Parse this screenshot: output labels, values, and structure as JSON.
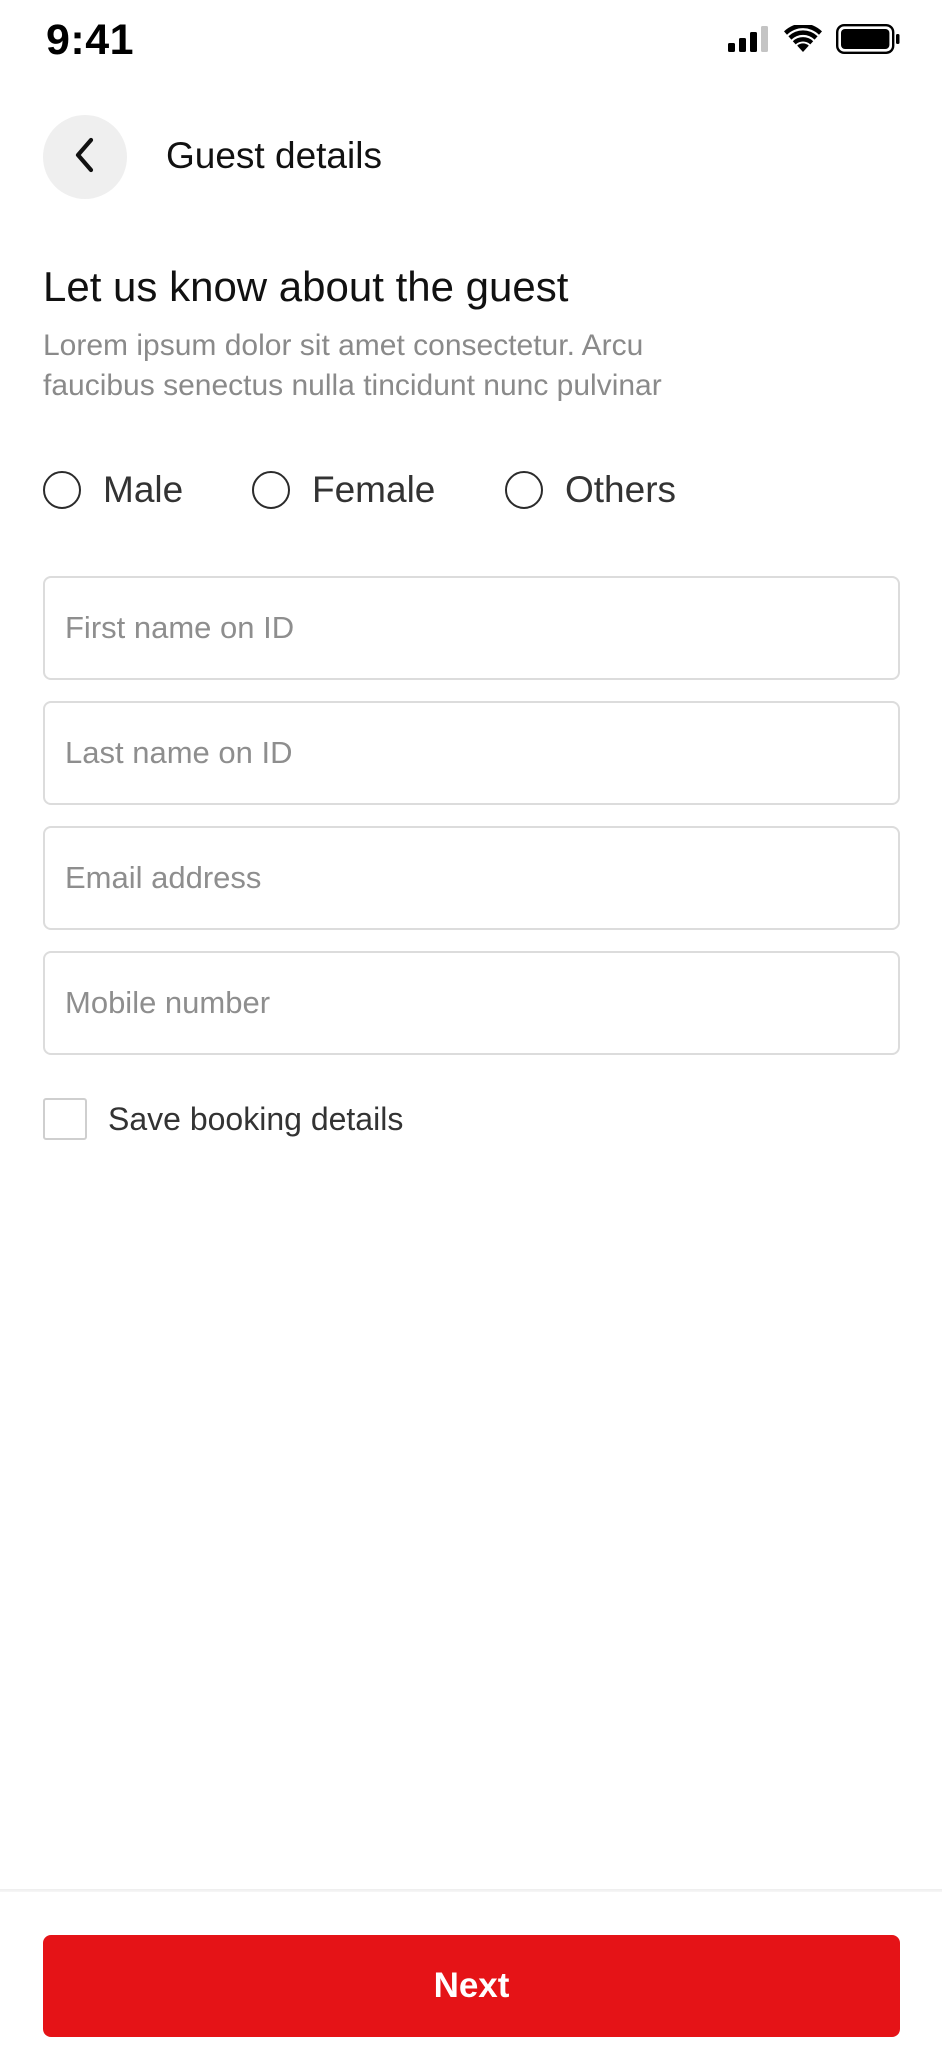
{
  "status_bar": {
    "time": "9:41",
    "icons": [
      "cellular-signal-icon",
      "wifi-icon",
      "battery-icon"
    ]
  },
  "header": {
    "back_icon": "chevron-left-icon",
    "title": "Guest details"
  },
  "section": {
    "title": "Let us know about the guest",
    "description": "Lorem ipsum dolor sit amet consectetur. Arcu faucibus senectus nulla tincidunt nunc pulvinar"
  },
  "gender_options": [
    {
      "label": "Male",
      "selected": false
    },
    {
      "label": "Female",
      "selected": false
    },
    {
      "label": "Others",
      "selected": false
    }
  ],
  "form": {
    "first_name": {
      "placeholder": "First name on ID",
      "value": ""
    },
    "last_name": {
      "placeholder": "Last name on ID",
      "value": ""
    },
    "email": {
      "placeholder": "Email address",
      "value": ""
    },
    "mobile": {
      "placeholder": "Mobile number",
      "value": ""
    }
  },
  "save_details": {
    "label": "Save booking details",
    "checked": false
  },
  "footer": {
    "next_label": "Next"
  },
  "colors": {
    "accent": "#e51317",
    "back_button_bg": "#efefef",
    "muted_text": "#8a8a8a",
    "border": "#dcdcdc"
  }
}
